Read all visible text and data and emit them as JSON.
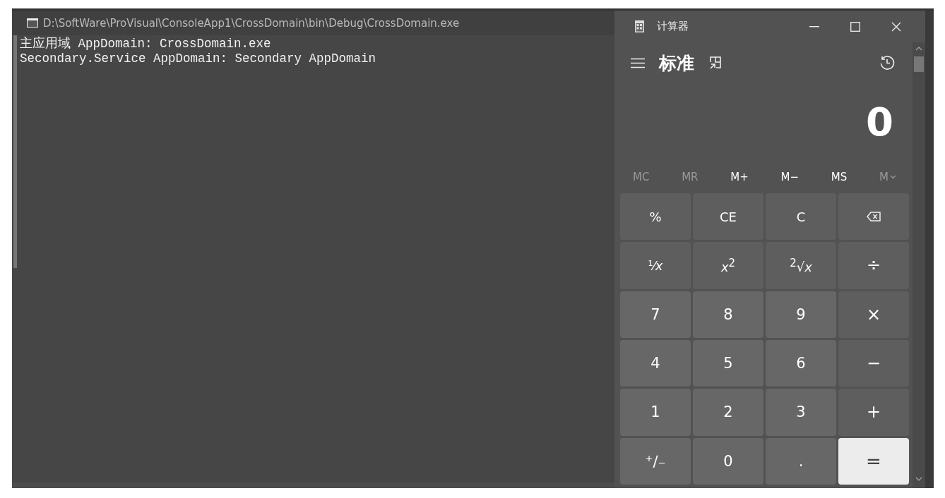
{
  "console": {
    "title": "D:\\SoftWare\\ProVisual\\ConsoleApp1\\CrossDomain\\bin\\Debug\\CrossDomain.exe",
    "lines": [
      "主应用域 AppDomain: CrossDomain.exe",
      "Secondary.Service AppDomain: Secondary AppDomain"
    ]
  },
  "calculator": {
    "title": "计算器",
    "mode": "标准",
    "display": "0",
    "memory": [
      {
        "label": "MC",
        "disabled": true
      },
      {
        "label": "MR",
        "disabled": true
      },
      {
        "label": "M+",
        "disabled": false
      },
      {
        "label": "M−",
        "disabled": false
      },
      {
        "label": "MS",
        "disabled": false
      },
      {
        "label": "M",
        "disabled": true,
        "kind": "dropdown"
      }
    ],
    "keys": [
      {
        "label": "%",
        "kind": "function"
      },
      {
        "label": "CE",
        "kind": "function"
      },
      {
        "label": "C",
        "kind": "function"
      },
      {
        "kind": "backspace"
      },
      {
        "label": "¹⁄*x*",
        "kind": "function"
      },
      {
        "label": "*x*$^{2}$",
        "kind": "function"
      },
      {
        "label": "$^{2}$√*x*",
        "kind": "function"
      },
      {
        "label": "÷",
        "kind": "operator"
      },
      {
        "label": "7",
        "kind": "digit"
      },
      {
        "label": "8",
        "kind": "digit"
      },
      {
        "label": "9",
        "kind": "digit"
      },
      {
        "label": "×",
        "kind": "operator"
      },
      {
        "label": "4",
        "kind": "digit"
      },
      {
        "label": "5",
        "kind": "digit"
      },
      {
        "label": "6",
        "kind": "digit"
      },
      {
        "label": "−",
        "kind": "operator"
      },
      {
        "label": "1",
        "kind": "digit"
      },
      {
        "label": "2",
        "kind": "digit"
      },
      {
        "label": "3",
        "kind": "digit"
      },
      {
        "label": "+",
        "kind": "operator"
      },
      {
        "label": "⁺∕₋",
        "kind": "digit"
      },
      {
        "label": "0",
        "kind": "digit"
      },
      {
        "label": ".",
        "kind": "digit"
      },
      {
        "label": "=",
        "kind": "equals"
      }
    ]
  }
}
